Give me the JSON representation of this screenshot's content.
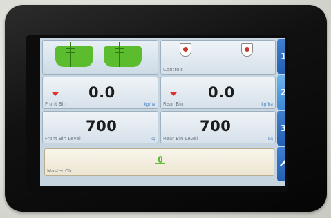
{
  "tiles": {
    "bins_graphic": {
      "label": ""
    },
    "controls": {
      "label": "Controls"
    },
    "front_bin": {
      "label": "Front Bin",
      "value": "0.0",
      "unit": "kg/ha"
    },
    "rear_bin": {
      "label": "Rear Bin",
      "value": "0.0",
      "unit": "kg/ha"
    },
    "front_bin_level": {
      "label": "Front Bin Level",
      "value": "700",
      "unit": "kg"
    },
    "rear_bin_level": {
      "label": "Rear Bin Level",
      "value": "700",
      "unit": "kg"
    },
    "status": {
      "label": "Master Ctrl"
    }
  },
  "sidebar": {
    "tabs": [
      {
        "label": "1"
      },
      {
        "label": "2"
      },
      {
        "label": "3"
      },
      {
        "label": ""
      }
    ]
  },
  "colors": {
    "accent_tab": "#2460b2",
    "bin_green": "#5bbd2e",
    "arrow_red": "#e0322c"
  }
}
